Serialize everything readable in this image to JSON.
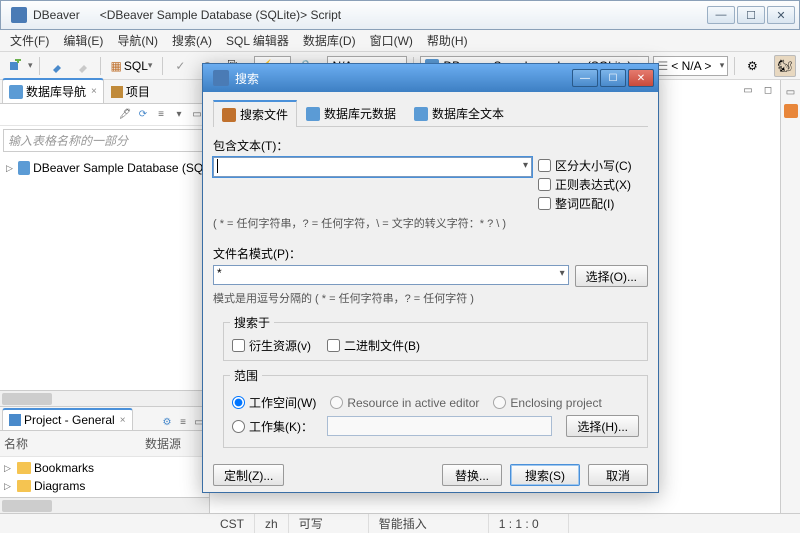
{
  "window": {
    "app_name": "DBeaver",
    "doc_title": "<DBeaver Sample Database (SQLite)> Script"
  },
  "menu": {
    "file": "文件(F)",
    "edit": "编辑(E)",
    "nav": "导航(N)",
    "search": "搜索(A)",
    "sql": "SQL 编辑器",
    "db": "数据库(D)",
    "window": "窗口(W)",
    "help": "帮助(H)"
  },
  "toolbar": {
    "sql_label": "SQL",
    "na": "N/A",
    "conn_label": "DBeaver Sample  ... abase (SQLite)",
    "na2": "< N/A >"
  },
  "nav": {
    "tab_db": "数据库导航",
    "tab_proj": "项目",
    "filter_placeholder": "输入表格名称的一部分",
    "tree_item": "DBeaver Sample Database (SQLite)"
  },
  "project": {
    "tab": "Project - General",
    "col_name": "名称",
    "col_ds": "数据源",
    "bookmarks": "Bookmarks",
    "diagrams": "Diagrams"
  },
  "dialog": {
    "title": "搜索",
    "tabs": {
      "file": "搜索文件",
      "meta": "数据库元数据",
      "fulltext": "数据库全文本"
    },
    "contains_label": "包含文本(T)：",
    "wildcard_hint": "( * = 任何字符串，? = 任何字符，\\ = 文字的转义字符：* ? \\ )",
    "case": "区分大小写(C)",
    "regex": "正则表达式(X)",
    "whole": "整词匹配(I)",
    "pattern_label": "文件名模式(P)：",
    "pattern_value": "*",
    "choose": "选择(O)...",
    "pattern_hint": "模式是用逗号分隔的 ( * = 任何字符串，? = 任何字符 )",
    "search_in_legend": "搜索于",
    "derived": "衍生资源(v)",
    "binary": "二进制文件(B)",
    "scope_legend": "范围",
    "workspace": "工作空间(W)",
    "resource": "Resource in active editor",
    "enclosing": "Enclosing project",
    "working_set": "工作集(K)：",
    "choose2": "选择(H)...",
    "customize": "定制(Z)...",
    "replace": "替换...",
    "search": "搜索(S)",
    "cancel": "取消"
  },
  "status": {
    "tz": "CST",
    "lang": "zh",
    "rw": "可写",
    "ins": "智能插入",
    "pos": "1 : 1 : 0"
  }
}
